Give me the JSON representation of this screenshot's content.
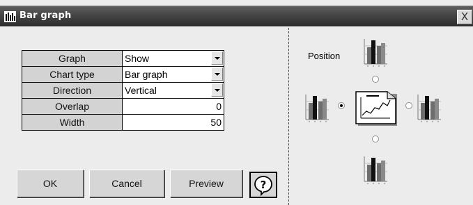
{
  "window": {
    "title": "Bar graph",
    "close_label": "X"
  },
  "properties": [
    {
      "label": "Graph",
      "value": "Show",
      "kind": "select"
    },
    {
      "label": "Chart type",
      "value": "Bar graph",
      "kind": "select"
    },
    {
      "label": "Direction",
      "value": "Vertical",
      "kind": "select"
    },
    {
      "label": "Overlap",
      "value": "0",
      "kind": "number"
    },
    {
      "label": "Width",
      "value": "50",
      "kind": "number"
    }
  ],
  "buttons": {
    "ok": "OK",
    "cancel": "Cancel",
    "preview": "Preview",
    "help_icon": "question-mark-icon"
  },
  "position": {
    "label": "Position",
    "options": [
      "top",
      "left",
      "right",
      "bottom"
    ],
    "selected": "left"
  },
  "colors": {
    "titlebar": "#3f3f3f",
    "label_cell": "#d3d3d3",
    "dialog_bg": "#ececec"
  }
}
